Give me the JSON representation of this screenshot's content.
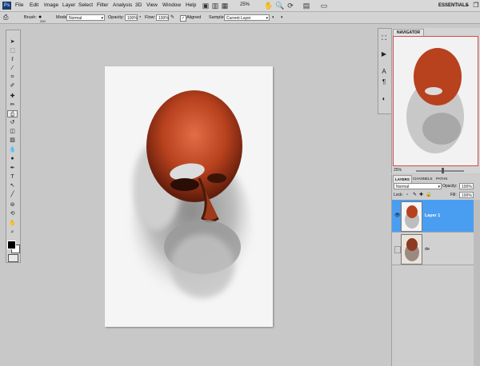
{
  "menu": [
    "File",
    "Edit",
    "Image",
    "Layer",
    "Select",
    "Filter",
    "Analysis",
    "3D",
    "View",
    "Window",
    "Help"
  ],
  "menubar": {
    "zoom": "25%",
    "workspace": "ESSENTIALS"
  },
  "options": {
    "brush_label": "Brush:",
    "brush_size": "200",
    "mode_label": "Mode:",
    "mode_value": "Normal",
    "opacity_label": "Opacity:",
    "opacity_value": "100%",
    "flow_label": "Flow:",
    "flow_value": "100%",
    "aligned_label": "Aligned",
    "sample_label": "Sample:",
    "sample_value": "Current Layer"
  },
  "navigator": {
    "tab": "NAVIGATOR",
    "zoom": "25%"
  },
  "layers": {
    "tabs": [
      "LAYERS",
      "CHANNELS",
      "PATHS"
    ],
    "blend_mode": "Normal",
    "opacity_label": "Opacity:",
    "opacity_value": "100%",
    "lock_label": "Lock:",
    "fill_label": "Fill:",
    "fill_value": "100%",
    "items": [
      {
        "name": "Layer 1",
        "selected": true
      },
      {
        "name": "de",
        "selected": false
      }
    ]
  },
  "colors": {
    "foreground": "#000000",
    "background": "#ffffff",
    "selection": "#4a9ef2"
  },
  "icons": {
    "tools": [
      "move-tool-icon",
      "marquee-tool-icon",
      "lasso-tool-icon",
      "quick-select-tool-icon",
      "crop-tool-icon",
      "eyedropper-tool-icon",
      "healing-brush-tool-icon",
      "brush-tool-icon",
      "clone-stamp-tool-icon",
      "history-brush-tool-icon",
      "eraser-tool-icon",
      "gradient-tool-icon",
      "blur-tool-icon",
      "dodge-tool-icon",
      "pen-tool-icon",
      "type-tool-icon",
      "path-select-tool-icon",
      "shape-tool-icon",
      "3d-rotate-tool-icon",
      "3d-orbit-tool-icon",
      "hand-tool-icon",
      "zoom-tool-icon"
    ]
  }
}
